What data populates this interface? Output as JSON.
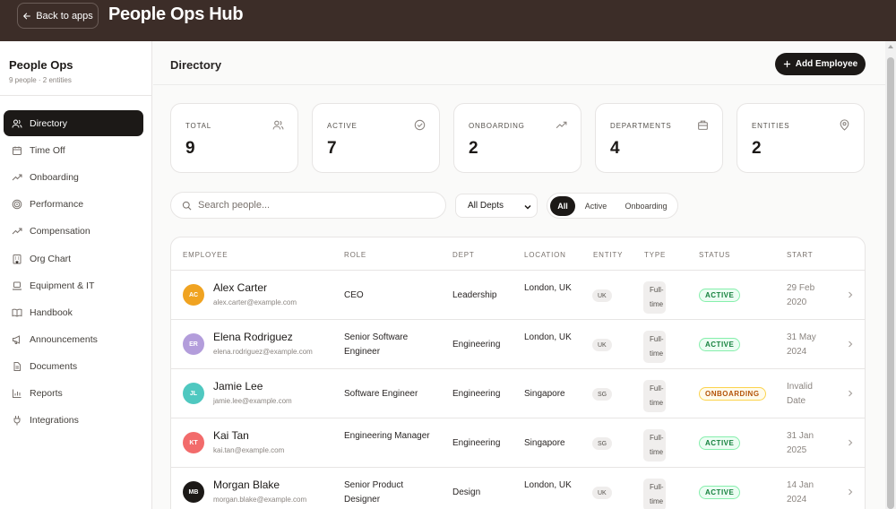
{
  "topbar": {
    "back_label": "Back to apps",
    "title": "People Ops Hub"
  },
  "sidebar": {
    "title": "People Ops",
    "subtitle": "9 people · 2 entities",
    "items": [
      {
        "label": "Directory",
        "icon": "users-icon"
      },
      {
        "label": "Time Off",
        "icon": "calendar-icon"
      },
      {
        "label": "Onboarding",
        "icon": "trending-icon"
      },
      {
        "label": "Performance",
        "icon": "target-icon"
      },
      {
        "label": "Compensation",
        "icon": "trending-icon"
      },
      {
        "label": "Org Chart",
        "icon": "building-icon"
      },
      {
        "label": "Equipment & IT",
        "icon": "laptop-icon"
      },
      {
        "label": "Handbook",
        "icon": "book-icon"
      },
      {
        "label": "Announcements",
        "icon": "megaphone-icon"
      },
      {
        "label": "Documents",
        "icon": "document-icon"
      },
      {
        "label": "Reports",
        "icon": "bar-chart-icon"
      },
      {
        "label": "Integrations",
        "icon": "plug-icon"
      }
    ]
  },
  "header": {
    "title": "Directory",
    "add_label": "Add Employee"
  },
  "stats": [
    {
      "label": "TOTAL",
      "value": "9",
      "icon": "users-icon"
    },
    {
      "label": "ACTIVE",
      "value": "7",
      "icon": "check-circle-icon"
    },
    {
      "label": "ONBOARDING",
      "value": "2",
      "icon": "trending-icon"
    },
    {
      "label": "DEPARTMENTS",
      "value": "4",
      "icon": "briefcase-icon"
    },
    {
      "label": "ENTITIES",
      "value": "2",
      "icon": "map-pin-icon"
    }
  ],
  "search": {
    "placeholder": "Search people...",
    "value": ""
  },
  "dept_select": {
    "selected": "All Depts"
  },
  "filters": [
    "All",
    "Active",
    "Onboarding"
  ],
  "table": {
    "columns": [
      "EMPLOYEE",
      "ROLE",
      "DEPT",
      "LOCATION",
      "ENTITY",
      "TYPE",
      "STATUS",
      "START"
    ],
    "rows": [
      {
        "initials": "AC",
        "avatar_color": "#f0a321",
        "name": "Alex Carter",
        "email": "alex.carter@example.com",
        "role": "CEO",
        "dept": "Leadership",
        "location": "London, UK",
        "entity": "UK",
        "type": "Full-time",
        "status": "ACTIVE",
        "start": "29 Feb 2020"
      },
      {
        "initials": "ER",
        "avatar_color": "#b39ddb",
        "name": "Elena Rodriguez",
        "email": "elena.rodriguez@example.com",
        "role": "Senior Software Engineer",
        "dept": "Engineering",
        "location": "London, UK",
        "entity": "UK",
        "type": "Full-time",
        "status": "ACTIVE",
        "start": "31 May 2024"
      },
      {
        "initials": "JL",
        "avatar_color": "#4fc8c0",
        "name": "Jamie Lee",
        "email": "jamie.lee@example.com",
        "role": "Software Engineer",
        "dept": "Engineering",
        "location": "Singapore",
        "entity": "SG",
        "type": "Full-time",
        "status": "ONBOARDING",
        "start": "Invalid Date"
      },
      {
        "initials": "KT",
        "avatar_color": "#f26b6b",
        "name": "Kai Tan",
        "email": "kai.tan@example.com",
        "role": "Engineering Manager",
        "dept": "Engineering",
        "location": "Singapore",
        "entity": "SG",
        "type": "Full-time",
        "status": "ACTIVE",
        "start": "31 Jan 2025"
      },
      {
        "initials": "MB",
        "avatar_color": "#1c1917",
        "name": "Morgan Blake",
        "email": "morgan.blake@example.com",
        "role": "Senior Product Designer",
        "dept": "Design",
        "location": "London, UK",
        "entity": "UK",
        "type": "Full-time",
        "status": "ACTIVE",
        "start": "14 Jan 2024"
      }
    ]
  }
}
